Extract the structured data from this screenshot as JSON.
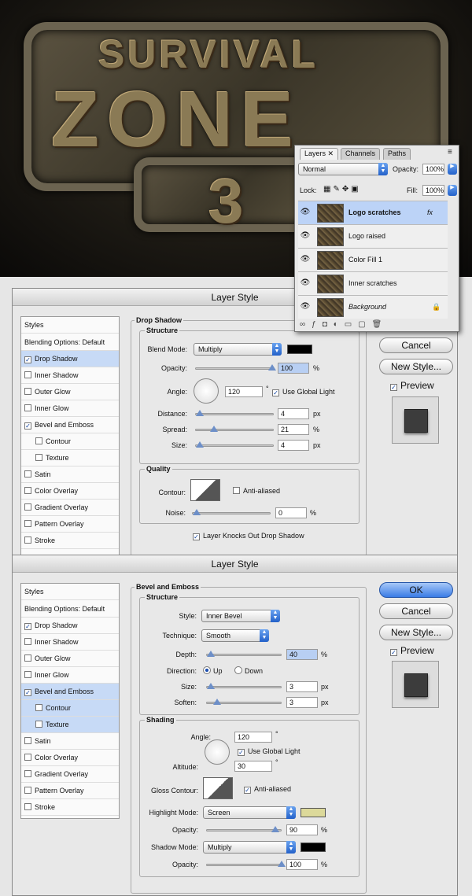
{
  "art": {
    "line1": "SURVIVAL",
    "line2": "ZONE",
    "line3": "3"
  },
  "layers_panel": {
    "tabs": [
      "Layers",
      "Channels",
      "Paths"
    ],
    "blend_mode": "Normal",
    "opacity_label": "Opacity:",
    "opacity_value": "100%",
    "lock_label": "Lock:",
    "fill_label": "Fill:",
    "fill_value": "100%",
    "layers": [
      {
        "name": "Logo scratches",
        "selected": true,
        "fx": "fx"
      },
      {
        "name": "Logo raised"
      },
      {
        "name": "Color Fill 1"
      },
      {
        "name": "Inner scratches"
      },
      {
        "name": "Background",
        "italic": true
      }
    ]
  },
  "dialog1": {
    "title": "Layer Style",
    "styles_header": "Styles",
    "blending": "Blending Options: Default",
    "items": [
      "Drop Shadow",
      "Inner Shadow",
      "Outer Glow",
      "Inner Glow",
      "Bevel and Emboss",
      "Contour",
      "Texture",
      "Satin",
      "Color Overlay",
      "Gradient Overlay",
      "Pattern Overlay",
      "Stroke"
    ],
    "checked": [
      true,
      false,
      false,
      false,
      true,
      false,
      false,
      false,
      false,
      false,
      false,
      false
    ],
    "section": "Drop Shadow",
    "structure": "Structure",
    "blend_mode_label": "Blend Mode:",
    "blend_mode": "Multiply",
    "opacity_label": "Opacity:",
    "opacity": "100",
    "angle_label": "Angle:",
    "angle": "120",
    "global_light": "Use Global Light",
    "distance_label": "Distance:",
    "distance": "4",
    "px": "px",
    "spread_label": "Spread:",
    "spread": "21",
    "pct": "%",
    "size_label": "Size:",
    "size": "4",
    "quality": "Quality",
    "contour_label": "Contour:",
    "anti_aliased": "Anti-aliased",
    "noise_label": "Noise:",
    "noise": "0",
    "knockout": "Layer Knocks Out Drop Shadow",
    "cancel": "Cancel",
    "new_style": "New Style...",
    "preview": "Preview"
  },
  "dialog2": {
    "title": "Layer Style",
    "section": "Bevel and Emboss",
    "structure": "Structure",
    "style_label": "Style:",
    "style": "Inner Bevel",
    "technique_label": "Technique:",
    "technique": "Smooth",
    "depth_label": "Depth:",
    "depth": "40",
    "direction_label": "Direction:",
    "up": "Up",
    "down": "Down",
    "size_label": "Size:",
    "size": "3",
    "soften_label": "Soften:",
    "soften": "3",
    "shading": "Shading",
    "angle_label": "Angle:",
    "angle": "120",
    "global_light": "Use Global Light",
    "altitude_label": "Altitude:",
    "altitude": "30",
    "gloss_label": "Gloss Contour:",
    "anti_aliased": "Anti-aliased",
    "highlight_label": "Highlight Mode:",
    "highlight": "Screen",
    "highlight_color": "#dcd99a",
    "hopacity": "90",
    "opacity_label": "Opacity:",
    "shadow_label": "Shadow Mode:",
    "shadow": "Multiply",
    "shadow_color": "#000000",
    "sopacity": "100",
    "ok": "OK",
    "cancel": "Cancel",
    "new_style": "New Style...",
    "preview": "Preview"
  }
}
